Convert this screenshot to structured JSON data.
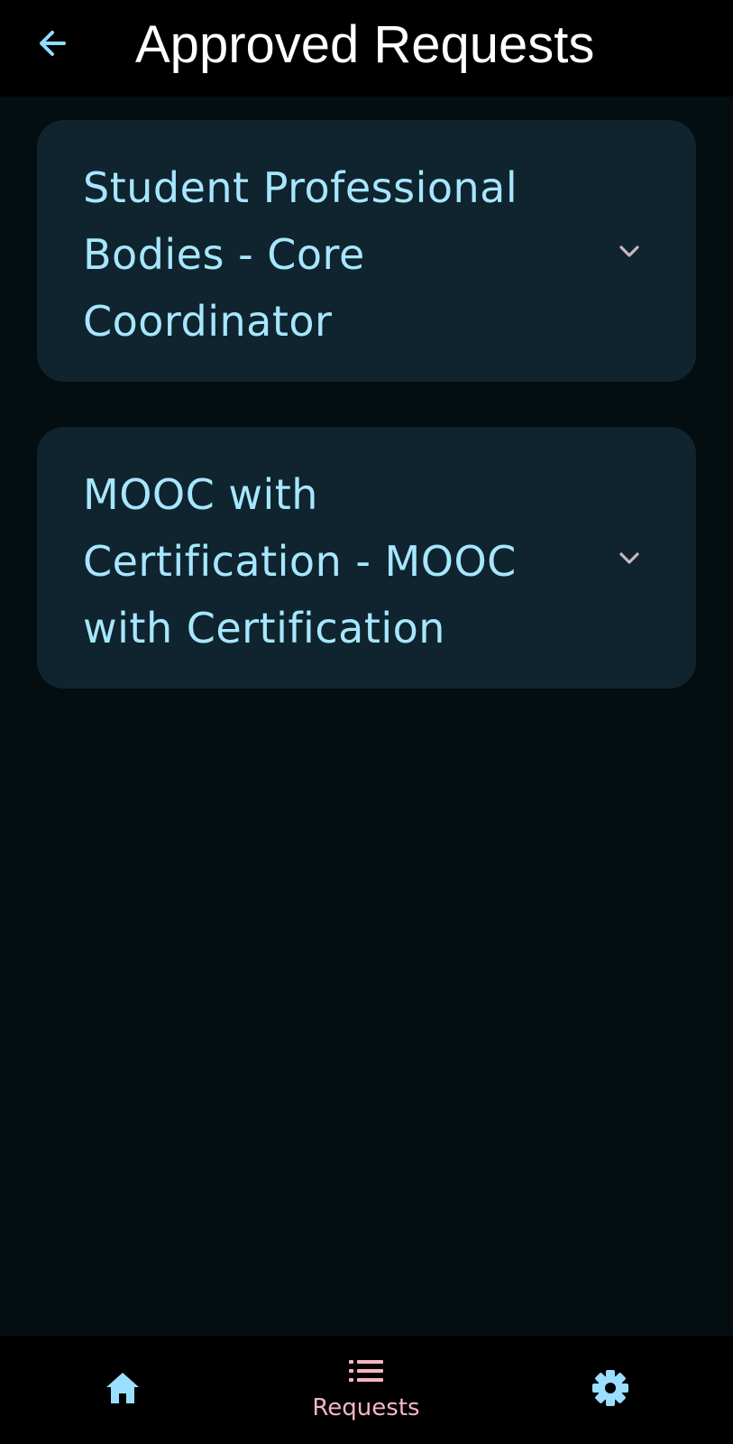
{
  "header": {
    "back_icon": "arrow-left-icon",
    "title": "Approved Requests"
  },
  "cards": [
    {
      "title": "Student Professional Bodies - Core Coordinator",
      "icon": "chevron-down-icon"
    },
    {
      "title": "MOOC with Certification - MOOC with Certification",
      "icon": "chevron-down-icon"
    }
  ],
  "bottom_nav": {
    "items": [
      {
        "icon": "home-icon",
        "label": ""
      },
      {
        "icon": "list-icon",
        "label": "Requests",
        "selected": true
      },
      {
        "icon": "gear-icon",
        "label": ""
      }
    ]
  },
  "colors": {
    "background": "#040d10",
    "app_bar": "#000000",
    "card": "#0f242e",
    "card_text": "#a6e7ff",
    "accent_icon": "#9adfff",
    "selected_nav": "#f4b6c2",
    "chevron": "#c7b8c0"
  }
}
